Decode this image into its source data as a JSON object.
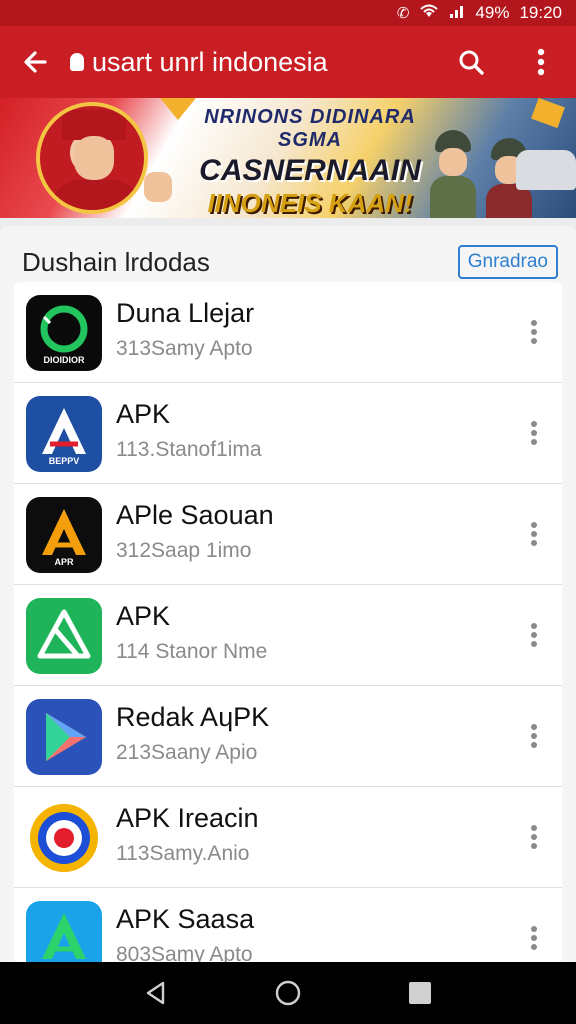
{
  "status_bar": {
    "time": "19:20",
    "battery": "49%"
  },
  "app_bar": {
    "title": "usart unrl indonesia"
  },
  "banner": {
    "line1": "NRINONS DIDINARA SGMA",
    "line2": "CASNERNAAIN",
    "line3": "IINONEIS KAAN!"
  },
  "section": {
    "title": "Dushain lrdodas",
    "link_label": "Gnradrao"
  },
  "apps": [
    {
      "name": "Duna Llejar",
      "meta": "313Samy Apto",
      "icon": "ring-icon",
      "bg": "#0a0a0a",
      "fg": "#22c55e",
      "label": "DIOIDIOR"
    },
    {
      "name": "APK",
      "meta": "113.Stanof1ima",
      "icon": "apk-a-icon",
      "bg": "#1f4fa3",
      "fg": "#ffffff",
      "label": "BEPPV"
    },
    {
      "name": "APle Saouan",
      "meta": "312Saap 1imo",
      "icon": "apk-a-icon",
      "bg": "#0d0d0d",
      "fg": "#f59e0b",
      "label": "APR"
    },
    {
      "name": "APK",
      "meta": "114 Stanor Nme",
      "icon": "apk-outline-icon",
      "bg": "#1fb45a",
      "fg": "#ffffff",
      "label": ""
    },
    {
      "name": "Redak AɥPK",
      "meta": "213Saany Apio",
      "icon": "play-icon",
      "bg": "#2a52b8",
      "fg": "#ffffff",
      "label": ""
    },
    {
      "name": "APK Ireacin",
      "meta": "113Samy.Anio",
      "icon": "badge-emblem-icon",
      "bg": "#ffffff",
      "fg": "#e35a1a",
      "label": ""
    },
    {
      "name": "APK Saasa",
      "meta": "803Samy Apto",
      "icon": "apk-a-icon",
      "bg": "#1aa3e8",
      "fg": "#2bd36a",
      "label": ""
    }
  ]
}
